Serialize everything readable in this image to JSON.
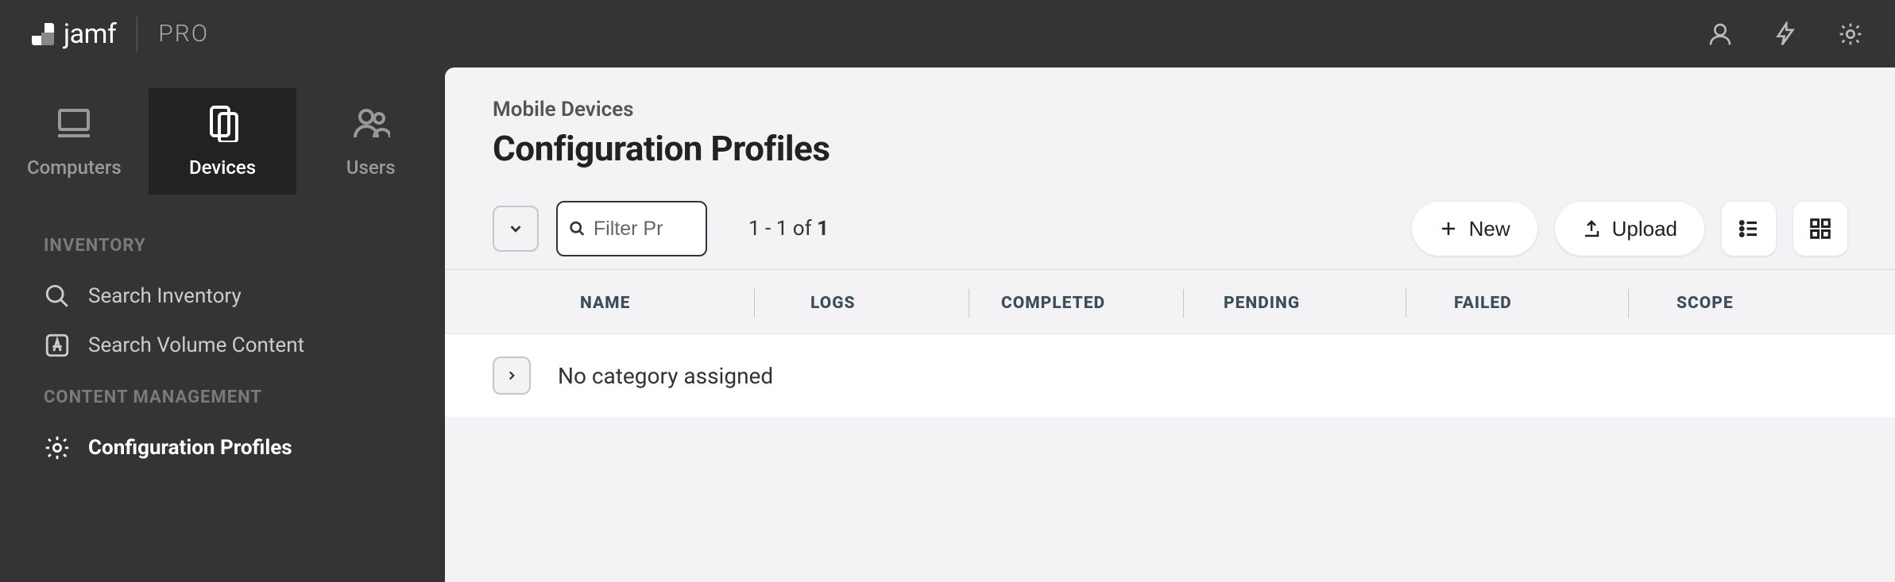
{
  "brand": {
    "name": "jamf",
    "edition": "PRO"
  },
  "nav_tabs": {
    "computers": "Computers",
    "devices": "Devices",
    "users": "Users"
  },
  "sidebar": {
    "sections": [
      {
        "title": "INVENTORY",
        "items": [
          {
            "label": "Search Inventory",
            "icon": "search"
          },
          {
            "label": "Search Volume Content",
            "icon": "appstore"
          }
        ]
      },
      {
        "title": "CONTENT MANAGEMENT",
        "items": [
          {
            "label": "Configuration Profiles",
            "icon": "gear"
          }
        ]
      }
    ]
  },
  "header": {
    "breadcrumb": "Mobile Devices",
    "title": "Configuration Profiles"
  },
  "toolbar": {
    "filter_placeholder": "Filter Pr",
    "count_prefix": "1 - 1 of ",
    "count_total": "1",
    "new_label": "New",
    "upload_label": "Upload"
  },
  "table": {
    "columns": {
      "name": "NAME",
      "logs": "LOGS",
      "completed": "COMPLETED",
      "pending": "PENDING",
      "failed": "FAILED",
      "scope": "SCOPE"
    },
    "groups": [
      {
        "label": "No category assigned"
      }
    ]
  }
}
